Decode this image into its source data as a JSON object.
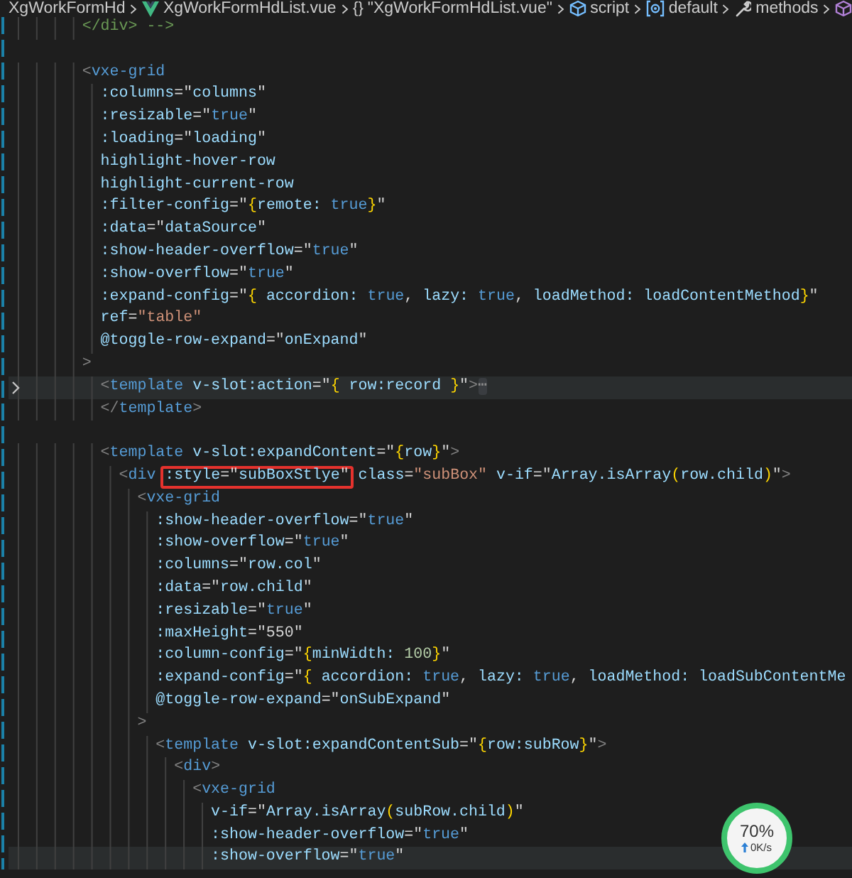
{
  "breadcrumb": [
    {
      "kind": "folder",
      "text": "XgWorkFormHd"
    },
    {
      "kind": "vue",
      "text": "XgWorkFormHdList.vue"
    },
    {
      "kind": "braces",
      "symbol": "{}",
      "text": "\"XgWorkFormHdList.vue\""
    },
    {
      "kind": "cube",
      "text": "script"
    },
    {
      "kind": "module",
      "text": "default"
    },
    {
      "kind": "wrench",
      "text": "methods"
    },
    {
      "kind": "method"
    }
  ],
  "lines": [
    {
      "highlighted": false,
      "folded": false,
      "tokens": [
        {
          "kind": "comment",
          "text": "        </div> -->"
        }
      ]
    },
    {
      "highlighted": false,
      "folded": false
    },
    {
      "highlighted": false,
      "folded": false,
      "tokens": [
        {
          "kind": "angle",
          "text": "        <"
        },
        {
          "kind": "tag",
          "text": "vxe-grid"
        }
      ]
    },
    {
      "highlighted": false,
      "folded": false,
      "tokens": [
        {
          "kind": "attr",
          "text": "          :columns"
        },
        {
          "kind": "text",
          "text": "=\""
        },
        {
          "kind": "attr",
          "text": "columns"
        },
        {
          "kind": "text",
          "text": "\""
        }
      ]
    },
    {
      "highlighted": false,
      "folded": false,
      "tokens": [
        {
          "kind": "attr",
          "text": "          :resizable"
        },
        {
          "kind": "text",
          "text": "=\""
        },
        {
          "kind": "keyword",
          "text": "true"
        },
        {
          "kind": "text",
          "text": "\""
        }
      ]
    },
    {
      "highlighted": false,
      "folded": false,
      "tokens": [
        {
          "kind": "attr",
          "text": "          :loading"
        },
        {
          "kind": "text",
          "text": "=\""
        },
        {
          "kind": "attr",
          "text": "loading"
        },
        {
          "kind": "text",
          "text": "\""
        }
      ]
    },
    {
      "highlighted": false,
      "folded": false,
      "tokens": [
        {
          "kind": "attr",
          "text": "          highlight-hover-row"
        }
      ]
    },
    {
      "highlighted": false,
      "folded": false,
      "tokens": [
        {
          "kind": "attr",
          "text": "          highlight-current-row"
        }
      ]
    },
    {
      "highlighted": false,
      "folded": false,
      "tokens": [
        {
          "kind": "attr",
          "text": "          :filter-config"
        },
        {
          "kind": "text",
          "text": "=\""
        },
        {
          "kind": "brace",
          "text": "{"
        },
        {
          "kind": "attr",
          "text": "remote:"
        },
        {
          "kind": "keyword",
          "text": " true"
        },
        {
          "kind": "brace",
          "text": "}"
        },
        {
          "kind": "text",
          "text": "\""
        }
      ]
    },
    {
      "highlighted": false,
      "folded": false,
      "tokens": [
        {
          "kind": "attr",
          "text": "          :data"
        },
        {
          "kind": "text",
          "text": "=\""
        },
        {
          "kind": "attr",
          "text": "dataSource"
        },
        {
          "kind": "text",
          "text": "\""
        }
      ]
    },
    {
      "highlighted": false,
      "folded": false,
      "tokens": [
        {
          "kind": "attr",
          "text": "          :show-header-overflow"
        },
        {
          "kind": "text",
          "text": "=\""
        },
        {
          "kind": "keyword",
          "text": "true"
        },
        {
          "kind": "text",
          "text": "\""
        }
      ]
    },
    {
      "highlighted": false,
      "folded": false,
      "tokens": [
        {
          "kind": "attr",
          "text": "          :show-overflow"
        },
        {
          "kind": "text",
          "text": "=\""
        },
        {
          "kind": "keyword",
          "text": "true"
        },
        {
          "kind": "text",
          "text": "\""
        }
      ]
    },
    {
      "highlighted": false,
      "folded": false,
      "tokens": [
        {
          "kind": "attr",
          "text": "          :expand-config"
        },
        {
          "kind": "text",
          "text": "=\""
        },
        {
          "kind": "brace",
          "text": "{"
        },
        {
          "kind": "attr",
          "text": " accordion:"
        },
        {
          "kind": "keyword",
          "text": " true"
        },
        {
          "kind": "text",
          "text": ", "
        },
        {
          "kind": "attr",
          "text": "lazy:"
        },
        {
          "kind": "keyword",
          "text": " true"
        },
        {
          "kind": "text",
          "text": ", "
        },
        {
          "kind": "attr",
          "text": "loadMethod: loadContentMethod"
        },
        {
          "kind": "brace",
          "text": "}"
        },
        {
          "kind": "text",
          "text": "\""
        }
      ]
    },
    {
      "highlighted": false,
      "folded": false,
      "tokens": [
        {
          "kind": "attr",
          "text": "          ref"
        },
        {
          "kind": "text",
          "text": "="
        },
        {
          "kind": "string",
          "text": "\"table\""
        }
      ]
    },
    {
      "highlighted": false,
      "folded": false,
      "tokens": [
        {
          "kind": "attr",
          "text": "          @toggle-row-expand"
        },
        {
          "kind": "text",
          "text": "=\""
        },
        {
          "kind": "attr",
          "text": "onExpand"
        },
        {
          "kind": "text",
          "text": "\""
        }
      ]
    },
    {
      "highlighted": false,
      "folded": false,
      "tokens": [
        {
          "kind": "angle",
          "text": "        >"
        }
      ]
    },
    {
      "highlighted": true,
      "folded": true,
      "tokens": [
        {
          "kind": "angle",
          "text": "          <"
        },
        {
          "kind": "tag",
          "text": "template"
        },
        {
          "kind": "attr",
          "text": " v-slot:action"
        },
        {
          "kind": "text",
          "text": "=\""
        },
        {
          "kind": "brace",
          "text": "{"
        },
        {
          "kind": "attr",
          "text": " row:record "
        },
        {
          "kind": "brace",
          "text": "}"
        },
        {
          "kind": "text",
          "text": "\""
        },
        {
          "kind": "angle",
          "text": ">"
        },
        {
          "kind": "fold",
          "text": "⋯"
        }
      ]
    },
    {
      "highlighted": false,
      "folded": false,
      "tokens": [
        {
          "kind": "angle",
          "text": "          </"
        },
        {
          "kind": "tag",
          "text": "template"
        },
        {
          "kind": "angle",
          "text": ">"
        }
      ]
    },
    {
      "highlighted": false,
      "folded": false
    },
    {
      "highlighted": false,
      "folded": false,
      "tokens": [
        {
          "kind": "angle",
          "text": "          <"
        },
        {
          "kind": "tag",
          "text": "template"
        },
        {
          "kind": "attr",
          "text": " v-slot:expandContent"
        },
        {
          "kind": "text",
          "text": "=\""
        },
        {
          "kind": "brace",
          "text": "{"
        },
        {
          "kind": "attr",
          "text": "row"
        },
        {
          "kind": "brace",
          "text": "}"
        },
        {
          "kind": "text",
          "text": "\""
        },
        {
          "kind": "angle",
          "text": ">"
        }
      ]
    },
    {
      "highlighted": false,
      "folded": false,
      "tokens": [
        {
          "kind": "angle",
          "text": "            <"
        },
        {
          "kind": "tag",
          "text": "div "
        },
        {
          "kind": "boxed",
          "tokens": [
            {
              "kind": "attr",
              "text": ":style"
            },
            {
              "kind": "text",
              "text": "=\""
            },
            {
              "kind": "attr",
              "text": "subBoxStlye"
            },
            {
              "kind": "text",
              "text": "\""
            }
          ]
        },
        {
          "kind": "attr",
          "text": " class"
        },
        {
          "kind": "text",
          "text": "="
        },
        {
          "kind": "string",
          "text": "\"subBox\""
        },
        {
          "kind": "attr",
          "text": " v-if"
        },
        {
          "kind": "text",
          "text": "=\""
        },
        {
          "kind": "attr",
          "text": "Array.isArray"
        },
        {
          "kind": "brace",
          "text": "("
        },
        {
          "kind": "attr",
          "text": "row.child"
        },
        {
          "kind": "brace",
          "text": ")"
        },
        {
          "kind": "text",
          "text": "\""
        },
        {
          "kind": "angle",
          "text": ">"
        }
      ]
    },
    {
      "highlighted": false,
      "folded": false,
      "tokens": [
        {
          "kind": "angle",
          "text": "              <"
        },
        {
          "kind": "tag",
          "text": "vxe-grid"
        }
      ]
    },
    {
      "highlighted": false,
      "folded": false,
      "tokens": [
        {
          "kind": "attr",
          "text": "                :show-header-overflow"
        },
        {
          "kind": "text",
          "text": "=\""
        },
        {
          "kind": "keyword",
          "text": "true"
        },
        {
          "kind": "text",
          "text": "\""
        }
      ]
    },
    {
      "highlighted": false,
      "folded": false,
      "tokens": [
        {
          "kind": "attr",
          "text": "                :show-overflow"
        },
        {
          "kind": "text",
          "text": "=\""
        },
        {
          "kind": "keyword",
          "text": "true"
        },
        {
          "kind": "text",
          "text": "\""
        }
      ]
    },
    {
      "highlighted": false,
      "folded": false,
      "tokens": [
        {
          "kind": "attr",
          "text": "                :columns"
        },
        {
          "kind": "text",
          "text": "=\""
        },
        {
          "kind": "attr",
          "text": "row.col"
        },
        {
          "kind": "text",
          "text": "\""
        }
      ]
    },
    {
      "highlighted": false,
      "folded": false,
      "tokens": [
        {
          "kind": "attr",
          "text": "                :data"
        },
        {
          "kind": "text",
          "text": "=\""
        },
        {
          "kind": "attr",
          "text": "row.child"
        },
        {
          "kind": "text",
          "text": "\""
        }
      ]
    },
    {
      "highlighted": false,
      "folded": false,
      "tokens": [
        {
          "kind": "attr",
          "text": "                :resizable"
        },
        {
          "kind": "text",
          "text": "=\""
        },
        {
          "kind": "keyword",
          "text": "true"
        },
        {
          "kind": "text",
          "text": "\""
        }
      ]
    },
    {
      "highlighted": false,
      "folded": false,
      "tokens": [
        {
          "kind": "attr",
          "text": "                :maxHeight"
        },
        {
          "kind": "text",
          "text": "=\"550\""
        }
      ]
    },
    {
      "highlighted": false,
      "folded": false,
      "tokens": [
        {
          "kind": "attr",
          "text": "                :column-config"
        },
        {
          "kind": "text",
          "text": "=\""
        },
        {
          "kind": "brace",
          "text": "{"
        },
        {
          "kind": "attr",
          "text": "minWidth:"
        },
        {
          "kind": "number",
          "text": " 100"
        },
        {
          "kind": "brace",
          "text": "}"
        },
        {
          "kind": "text",
          "text": "\""
        }
      ]
    },
    {
      "highlighted": false,
      "folded": false,
      "tokens": [
        {
          "kind": "attr",
          "text": "                :expand-config"
        },
        {
          "kind": "text",
          "text": "=\""
        },
        {
          "kind": "brace",
          "text": "{"
        },
        {
          "kind": "attr",
          "text": " accordion:"
        },
        {
          "kind": "keyword",
          "text": " true"
        },
        {
          "kind": "text",
          "text": ", "
        },
        {
          "kind": "attr",
          "text": "lazy:"
        },
        {
          "kind": "keyword",
          "text": " true"
        },
        {
          "kind": "text",
          "text": ", "
        },
        {
          "kind": "attr",
          "text": "loadMethod: loadSubContentMe"
        }
      ]
    },
    {
      "highlighted": false,
      "folded": false,
      "tokens": [
        {
          "kind": "attr",
          "text": "                @toggle-row-expand"
        },
        {
          "kind": "text",
          "text": "=\""
        },
        {
          "kind": "attr",
          "text": "onSubExpand"
        },
        {
          "kind": "text",
          "text": "\""
        }
      ]
    },
    {
      "highlighted": false,
      "folded": false,
      "tokens": [
        {
          "kind": "angle",
          "text": "              >"
        }
      ]
    },
    {
      "highlighted": false,
      "folded": false,
      "tokens": [
        {
          "kind": "angle",
          "text": "                <"
        },
        {
          "kind": "tag",
          "text": "template"
        },
        {
          "kind": "attr",
          "text": " v-slot:expandContentSub"
        },
        {
          "kind": "text",
          "text": "=\""
        },
        {
          "kind": "brace",
          "text": "{"
        },
        {
          "kind": "attr",
          "text": "row:subRow"
        },
        {
          "kind": "brace",
          "text": "}"
        },
        {
          "kind": "text",
          "text": "\""
        },
        {
          "kind": "angle",
          "text": ">"
        }
      ]
    },
    {
      "highlighted": false,
      "folded": false,
      "tokens": [
        {
          "kind": "angle",
          "text": "                  <"
        },
        {
          "kind": "tag",
          "text": "div"
        },
        {
          "kind": "angle",
          "text": ">"
        }
      ]
    },
    {
      "highlighted": false,
      "folded": false,
      "tokens": [
        {
          "kind": "angle",
          "text": "                    <"
        },
        {
          "kind": "tag",
          "text": "vxe-grid"
        }
      ]
    },
    {
      "highlighted": false,
      "folded": false,
      "tokens": [
        {
          "kind": "attr",
          "text": "                      v-if"
        },
        {
          "kind": "text",
          "text": "=\""
        },
        {
          "kind": "attr",
          "text": "Array.isArray"
        },
        {
          "kind": "brace",
          "text": "("
        },
        {
          "kind": "attr",
          "text": "subRow.child"
        },
        {
          "kind": "brace",
          "text": ")"
        },
        {
          "kind": "text",
          "text": "\""
        }
      ]
    },
    {
      "highlighted": false,
      "folded": false,
      "tokens": [
        {
          "kind": "attr",
          "text": "                      :show-header-overflow"
        },
        {
          "kind": "text",
          "text": "=\""
        },
        {
          "kind": "keyword",
          "text": "true"
        },
        {
          "kind": "text",
          "text": "\""
        }
      ]
    },
    {
      "highlighted": true,
      "folded": false,
      "tokens": [
        {
          "kind": "attr",
          "text": "                      :show-overflow"
        },
        {
          "kind": "text",
          "text": "=\""
        },
        {
          "kind": "keyword",
          "text": "true"
        },
        {
          "kind": "text",
          "text": "\""
        }
      ]
    }
  ],
  "speed_widget": {
    "percent": "70%",
    "upload": "0K/s"
  }
}
